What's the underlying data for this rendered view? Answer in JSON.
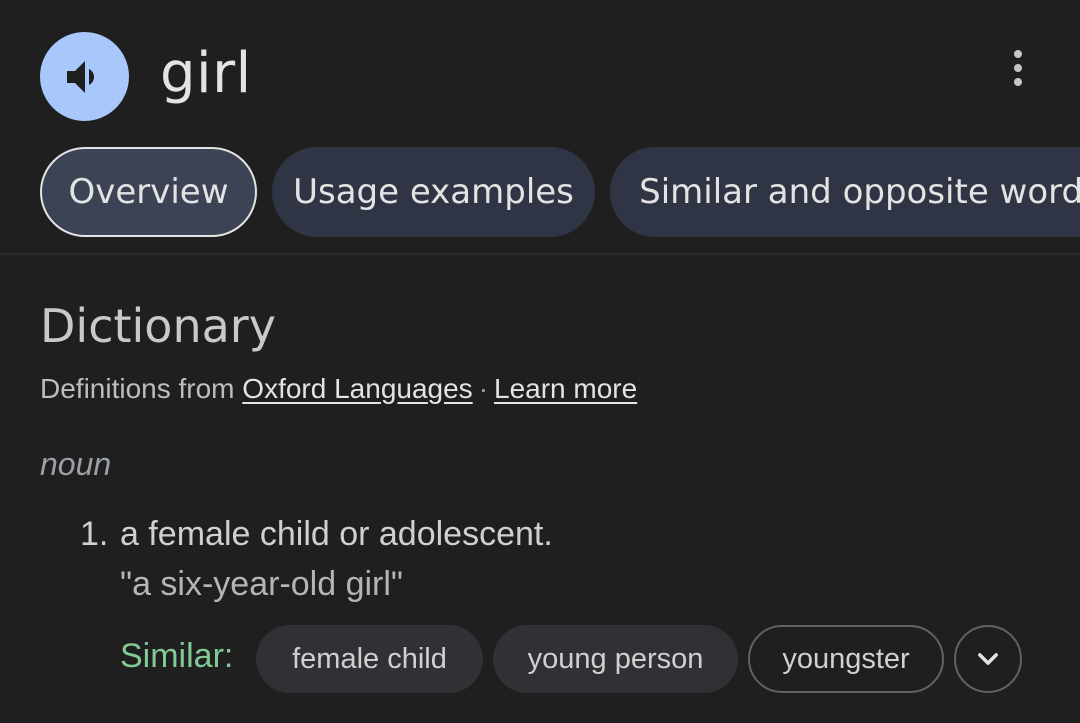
{
  "header": {
    "word": "girl",
    "speaker_icon": "volume-up-icon",
    "more_icon": "more-vert-icon"
  },
  "tabs": [
    {
      "label": "Overview",
      "active": true
    },
    {
      "label": "Usage examples",
      "active": false
    },
    {
      "label": "Similar and opposite words",
      "active": false
    }
  ],
  "dictionary": {
    "title": "Dictionary",
    "source_prefix": "Definitions from",
    "source_link": "Oxford Languages",
    "separator": "·",
    "learn_more": "Learn more",
    "part_of_speech": "noun",
    "definitions": [
      {
        "number": "1.",
        "text": "a female child or adolescent.",
        "example": "\"a six-year-old girl\""
      }
    ],
    "similar_label": "Similar:",
    "similar_words": [
      "female child",
      "young person",
      "youngster"
    ],
    "expand_icon": "chevron-down-icon"
  },
  "colors": {
    "background": "#1f1f1f",
    "speaker_button": "#a8c7fa",
    "tab_background": "#303545",
    "similar_label": "#81c995"
  }
}
